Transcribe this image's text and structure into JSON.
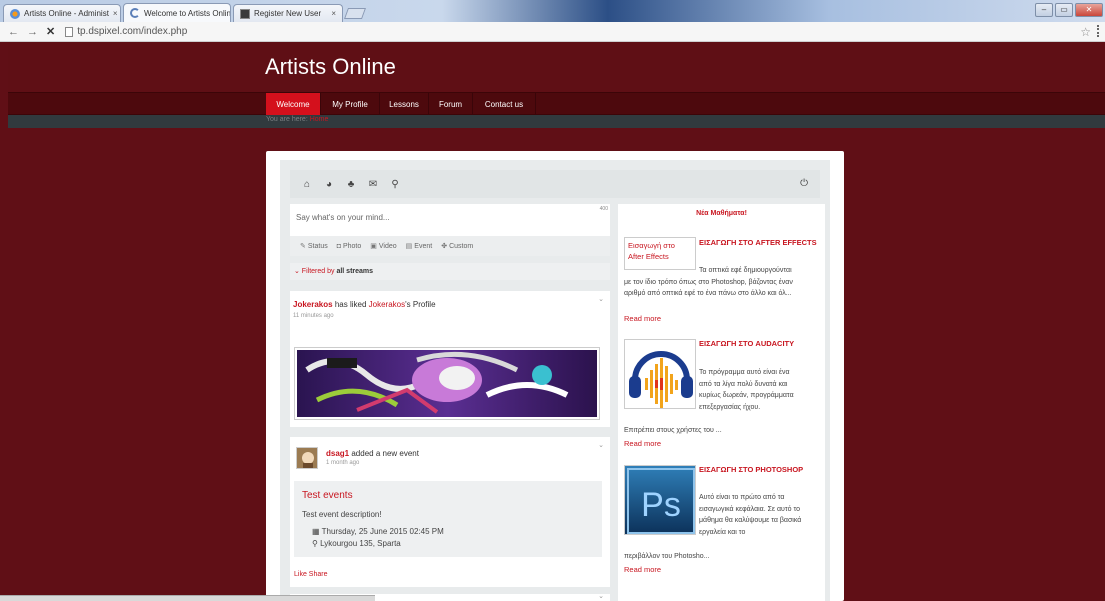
{
  "browser": {
    "tabs": [
      {
        "title": "Artists Online - Administ",
        "icon": "joomla-icon",
        "close": "×"
      },
      {
        "title": "Welcome to Artists Online",
        "icon": "loading-icon",
        "close": "×"
      },
      {
        "title": "Register New User",
        "icon": "site-icon",
        "close": "×"
      }
    ],
    "url": "tp.dspixel.com/index.php",
    "back": "←",
    "forward": "→",
    "stop": "✕",
    "bookmark_star": "☆",
    "window_controls": [
      "–",
      "▭",
      "✕"
    ]
  },
  "site": {
    "title": "Artists Online",
    "nav": [
      "Welcome",
      "My Profile",
      "Lessons",
      "Forum",
      "Contact us"
    ],
    "active_nav": "Welcome",
    "breadcrumb_prefix": "You are here:",
    "breadcrumb_home": "Home"
  },
  "stream": {
    "toolbar_icons": [
      "home-icon",
      "globe-icon",
      "people-icon",
      "mail-icon",
      "search-icon"
    ],
    "toolbar_glyphs": [
      "⌂",
      "◕",
      "♣",
      "✉",
      "⚲"
    ],
    "power_glyph": "⏻",
    "status_placeholder": "Say what's on your mind...",
    "char_count": "400",
    "post_types": [
      {
        "icon": "✎",
        "label": "Status"
      },
      {
        "icon": "◘",
        "label": "Photo"
      },
      {
        "icon": "▣",
        "label": "Video"
      },
      {
        "icon": "▤",
        "label": "Event"
      },
      {
        "icon": "✤",
        "label": "Custom"
      }
    ],
    "filter_prefix": "⌄ Filtered by",
    "filter_value": "all streams",
    "post1": {
      "actor": "Jokerakos",
      "verb": "has liked",
      "target": "Jokerakos",
      "suffix": "'s Profile",
      "time": "11 minutes ago"
    },
    "post2": {
      "actor": "dsag1",
      "verb": "added a new event",
      "time": "1 month ago",
      "event_title": "Test events",
      "event_desc": "Test event description!",
      "event_date": "Thursday, 25 June 2015 02:45 PM",
      "event_location": "Lykourgou 135, Sparta",
      "like": "Like",
      "share": "Share"
    },
    "chevron": "⌄"
  },
  "lessons": {
    "heading": "Νέα Μαθήματα!",
    "items": [
      {
        "title": "ΕΙΣΑΓΩΓΗ ΣΤΟ AFTER EFFECTS",
        "alt": "Εισαγωγή στο After Effects",
        "text": "Τα οπτικά εφέ δημιουργούνται με τον ίδιο τρόπο όπως στο Photoshop, βάζοντας έναν αριθμό από οπτικά εφέ το ένα πάνω στο άλλο και όλ...",
        "more": "Read more"
      },
      {
        "title": "ΕΙΣΑΓΩΓΗ ΣΤΟ AUDACITY",
        "text_side": "Το πρόγραμμα αυτό είναι ένα από τα λίγα πολύ δυνατά και κυρίως δωρεάν, προγράμματα επεξεργασίας ήχου.",
        "text_below": "Επιτρέπει στους χρήστες του ...",
        "more": "Read more"
      },
      {
        "title": "ΕΙΣΑΓΩΓΗ ΣΤΟ PHOTOSHOP",
        "text_side": "Αυτό είναι το πρώτο από τα εισαγωγικά κεφάλαια. Σε αυτό το μάθημα θα καλύψουμε τα βασικά εργαλεία και το",
        "text_below": "περιβάλλον του Photosho...",
        "more": "Read more",
        "logo_text": "Ps"
      }
    ]
  }
}
